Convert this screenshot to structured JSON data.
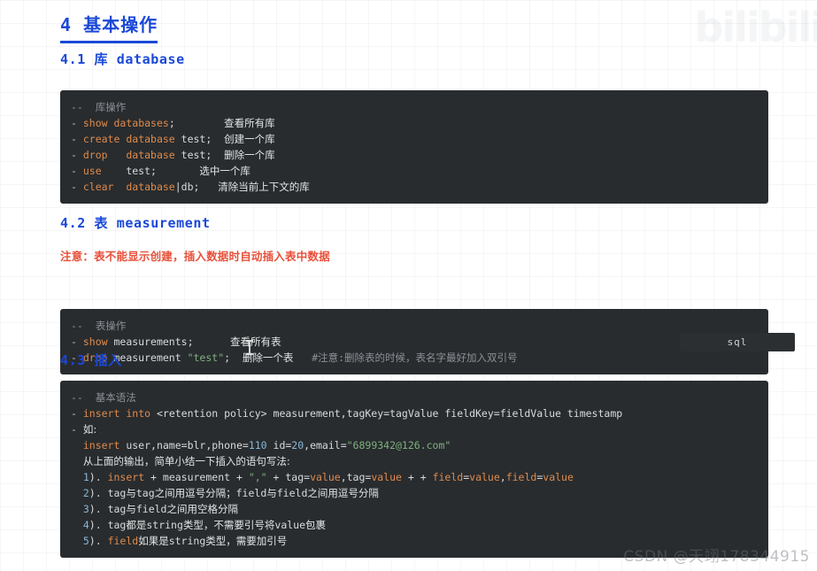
{
  "page": {
    "heading": "4  基本操作",
    "watermark_top": "bilibili",
    "watermark_bottom": "CSDN @天翊178344915"
  },
  "sections": [
    {
      "id": "4.1",
      "heading": "4.1 库 database",
      "note": null,
      "code_lines": [
        [
          {
            "t": "cmt",
            "v": "--  库操作"
          }
        ],
        [
          {
            "t": "dash",
            "v": "- "
          },
          {
            "t": "kw",
            "v": "show"
          },
          {
            "t": "plain",
            "v": " "
          },
          {
            "t": "kw",
            "v": "databases"
          },
          {
            "t": "plain",
            "v": ";        "
          },
          {
            "t": "han",
            "v": "查看所有库"
          }
        ],
        [
          {
            "t": "dash",
            "v": "- "
          },
          {
            "t": "kw",
            "v": "create"
          },
          {
            "t": "plain",
            "v": " "
          },
          {
            "t": "kw",
            "v": "database"
          },
          {
            "t": "plain",
            "v": " test;  "
          },
          {
            "t": "han",
            "v": "创建一个库"
          }
        ],
        [
          {
            "t": "dash",
            "v": "- "
          },
          {
            "t": "kw",
            "v": "drop"
          },
          {
            "t": "plain",
            "v": "   "
          },
          {
            "t": "kw",
            "v": "database"
          },
          {
            "t": "plain",
            "v": " test;  "
          },
          {
            "t": "han",
            "v": "删除一个库"
          }
        ],
        [
          {
            "t": "dash",
            "v": "- "
          },
          {
            "t": "kw",
            "v": "use"
          },
          {
            "t": "plain",
            "v": "    test;       "
          },
          {
            "t": "han",
            "v": "选中一个库"
          }
        ],
        [
          {
            "t": "dash",
            "v": "- "
          },
          {
            "t": "kw",
            "v": "clear"
          },
          {
            "t": "plain",
            "v": "  "
          },
          {
            "t": "kw",
            "v": "database"
          },
          {
            "t": "plain",
            "v": "|db;   "
          },
          {
            "t": "han",
            "v": "清除当前上下文的库"
          }
        ]
      ]
    },
    {
      "id": "4.2",
      "heading": "4.2 表 measurement",
      "note": "注意：表不能显示创建，插入数据时自动插入表中数据",
      "code_lines": [
        [
          {
            "t": "cmt",
            "v": "--  表操作"
          }
        ],
        [
          {
            "t": "dash",
            "v": "- "
          },
          {
            "t": "kw",
            "v": "show"
          },
          {
            "t": "plain",
            "v": " measurements;      "
          },
          {
            "t": "han",
            "v": "查看所有表"
          }
        ],
        [
          {
            "t": "dash",
            "v": "- "
          },
          {
            "t": "kw",
            "v": "drop"
          },
          {
            "t": "plain",
            "v": " measurement "
          },
          {
            "t": "str",
            "v": "\"test\""
          },
          {
            "t": "plain",
            "v": ";  "
          },
          {
            "t": "han",
            "v": "删除一个表"
          },
          {
            "t": "plain",
            "v": "   "
          },
          {
            "t": "cmt",
            "v": "#注意:删除表的时候，表名字最好加入双引号"
          }
        ]
      ]
    },
    {
      "id": "4.3",
      "heading": "4.3 插入",
      "note": null,
      "code_lines": [
        [
          {
            "t": "cmt",
            "v": "--  基本语法"
          }
        ],
        [
          {
            "t": "dash",
            "v": "- "
          },
          {
            "t": "kw",
            "v": "insert"
          },
          {
            "t": "plain",
            "v": " "
          },
          {
            "t": "kw",
            "v": "into"
          },
          {
            "t": "plain",
            "v": " <retention policy> measurement,tagKey=tagValue fieldKey=fieldValue timestamp"
          }
        ],
        [
          {
            "t": "dash",
            "v": "- "
          },
          {
            "t": "han",
            "v": "如:"
          }
        ],
        [
          {
            "t": "plain",
            "v": "  "
          },
          {
            "t": "kw",
            "v": "insert"
          },
          {
            "t": "plain",
            "v": " user,name=blr,phone="
          },
          {
            "t": "num",
            "v": "110"
          },
          {
            "t": "plain",
            "v": " id="
          },
          {
            "t": "num",
            "v": "20"
          },
          {
            "t": "plain",
            "v": ",email="
          },
          {
            "t": "str",
            "v": "\"6899342@126.com\""
          }
        ],
        [
          {
            "t": "plain",
            "v": "  "
          },
          {
            "t": "han",
            "v": "从上面的输出，简单小结一下插入的语句写法:"
          }
        ],
        [
          {
            "t": "plain",
            "v": "  "
          },
          {
            "t": "idx",
            "v": "1"
          },
          {
            "t": "plain",
            "v": "). "
          },
          {
            "t": "kw",
            "v": "insert"
          },
          {
            "t": "plain",
            "v": " + measurement + "
          },
          {
            "t": "str",
            "v": "\",\""
          },
          {
            "t": "plain",
            "v": " + tag="
          },
          {
            "t": "kw",
            "v": "value"
          },
          {
            "t": "plain",
            "v": ",tag="
          },
          {
            "t": "kw",
            "v": "value"
          },
          {
            "t": "plain",
            "v": " + + "
          },
          {
            "t": "kw",
            "v": "field"
          },
          {
            "t": "plain",
            "v": "="
          },
          {
            "t": "kw",
            "v": "value"
          },
          {
            "t": "plain",
            "v": ","
          },
          {
            "t": "kw",
            "v": "field"
          },
          {
            "t": "plain",
            "v": "="
          },
          {
            "t": "kw",
            "v": "value"
          }
        ],
        [
          {
            "t": "plain",
            "v": "  "
          },
          {
            "t": "idx",
            "v": "2"
          },
          {
            "t": "plain",
            "v": "). tag"
          },
          {
            "t": "han",
            "v": "与"
          },
          {
            "t": "plain",
            "v": "tag"
          },
          {
            "t": "han",
            "v": "之间用逗号分隔；"
          },
          {
            "t": "plain",
            "v": "field"
          },
          {
            "t": "han",
            "v": "与"
          },
          {
            "t": "plain",
            "v": "field"
          },
          {
            "t": "han",
            "v": "之间用逗号分隔"
          }
        ],
        [
          {
            "t": "plain",
            "v": "  "
          },
          {
            "t": "idx",
            "v": "3"
          },
          {
            "t": "plain",
            "v": "). tag"
          },
          {
            "t": "han",
            "v": "与"
          },
          {
            "t": "plain",
            "v": "field"
          },
          {
            "t": "han",
            "v": "之间用空格分隔"
          }
        ],
        [
          {
            "t": "plain",
            "v": "  "
          },
          {
            "t": "idx",
            "v": "4"
          },
          {
            "t": "plain",
            "v": "). tag"
          },
          {
            "t": "han",
            "v": "都是"
          },
          {
            "t": "plain",
            "v": "string"
          },
          {
            "t": "han",
            "v": "类型，不需要引号将"
          },
          {
            "t": "plain",
            "v": "value"
          },
          {
            "t": "han",
            "v": "包裹"
          }
        ],
        [
          {
            "t": "plain",
            "v": "  "
          },
          {
            "t": "idx",
            "v": "5"
          },
          {
            "t": "plain",
            "v": "). "
          },
          {
            "t": "kw",
            "v": "field"
          },
          {
            "t": "han",
            "v": "如果是"
          },
          {
            "t": "plain",
            "v": "string"
          },
          {
            "t": "han",
            "v": "类型，需要加引号"
          }
        ]
      ]
    }
  ],
  "sql_tag": {
    "label": "sql"
  },
  "colors": {
    "heading": "#1a48d8",
    "note": "#e8503a",
    "code_bg": "#282c2f",
    "keyword": "#e08a4b",
    "string": "#7fb07c",
    "number": "#8ab7d6",
    "comment": "#8d9196",
    "text": "#d9dadb"
  }
}
